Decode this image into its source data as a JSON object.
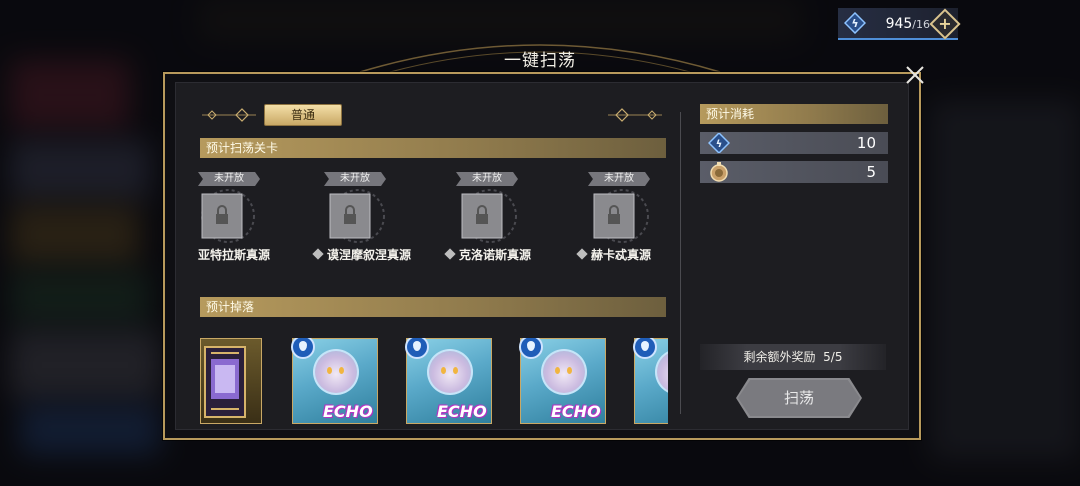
{
  "currency": {
    "amount": "945",
    "cap": "/16",
    "plus": "+"
  },
  "dialog": {
    "title": "一键扫荡",
    "close": "×"
  },
  "tabs": {
    "active_label": "普通"
  },
  "stages_section": {
    "title": "预计扫荡关卡",
    "stages": [
      {
        "badge": "未开放",
        "name": "亚特拉斯真源"
      },
      {
        "badge": "未开放",
        "name": "谟涅摩叙涅真源"
      },
      {
        "badge": "未开放",
        "name": "克洛诺斯真源"
      },
      {
        "badge": "未开放",
        "name": "赫卡忒真源"
      }
    ]
  },
  "drops_section": {
    "title": "预计掉落",
    "cards": [
      {
        "kind": "item"
      },
      {
        "kind": "echo",
        "label": "ECHO"
      },
      {
        "kind": "echo",
        "label": "ECHO"
      },
      {
        "kind": "echo",
        "label": "ECHO"
      },
      {
        "kind": "echo",
        "label": ""
      }
    ]
  },
  "cost_panel": {
    "title": "预计消耗",
    "rows": [
      {
        "icon": "stamina-icon",
        "value": "10"
      },
      {
        "icon": "ticket-icon",
        "value": "5"
      }
    ]
  },
  "bonus": {
    "label": "剩余额外奖励",
    "value": "5/5"
  },
  "sweep_button": {
    "label": "扫荡"
  },
  "colors": {
    "gold": "#b89a5c",
    "tab_gold": "#e6cc8e",
    "panel": "#1d1d21",
    "accent_blue": "#4f8fd8"
  }
}
